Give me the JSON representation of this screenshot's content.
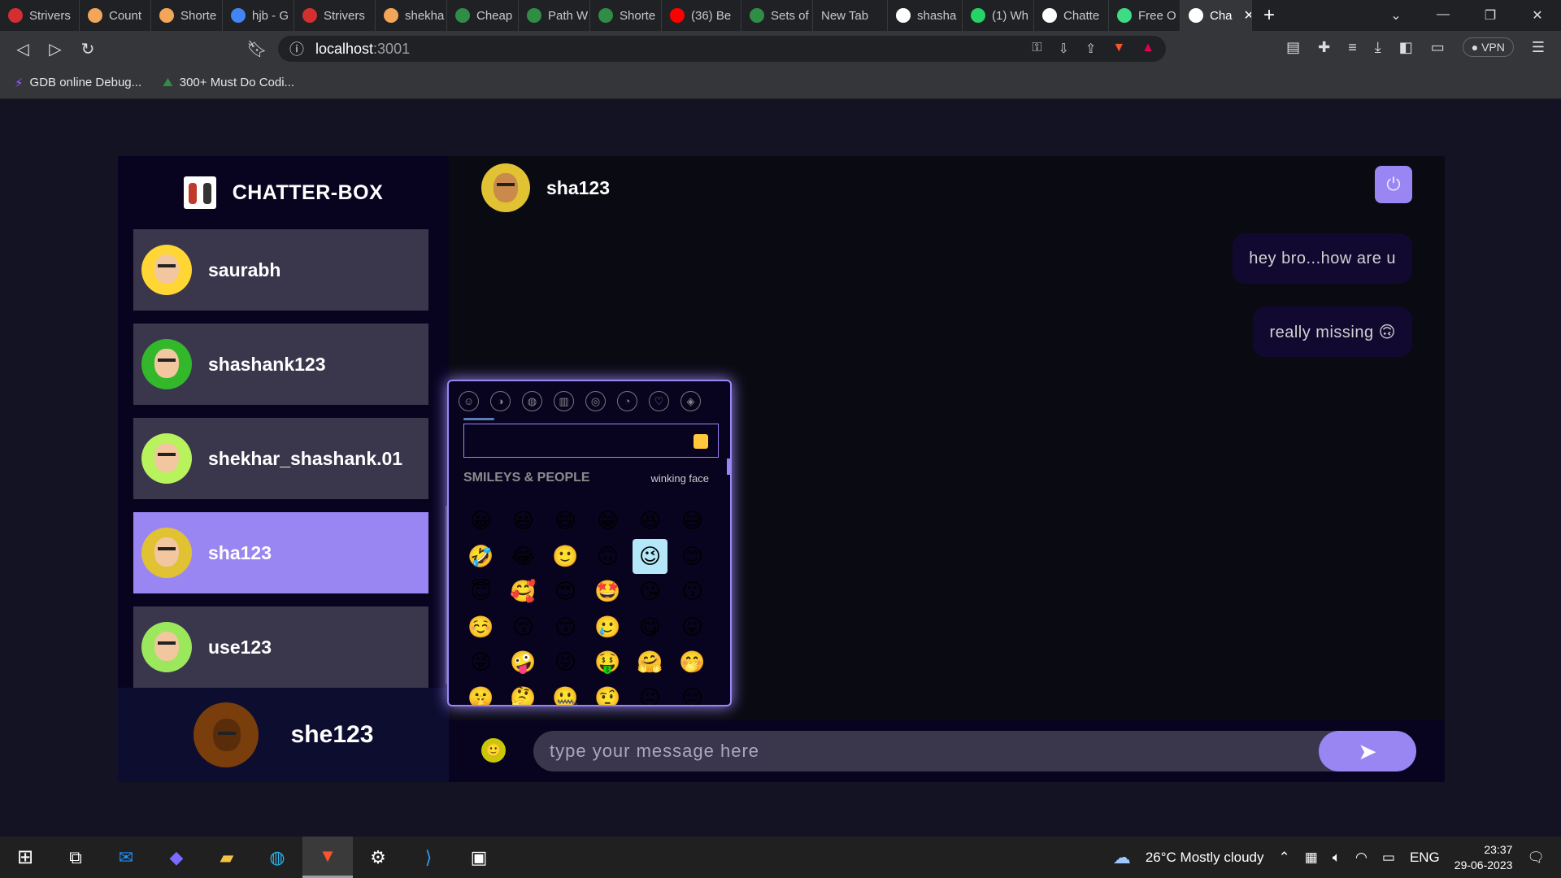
{
  "browser": {
    "tabs": [
      {
        "label": "Strivers",
        "color": "#d32f2f"
      },
      {
        "label": "Count",
        "color": "#f2a65a"
      },
      {
        "label": "Shorte",
        "color": "#f2a65a"
      },
      {
        "label": "hjb - G",
        "color": "#4285f4"
      },
      {
        "label": "Strivers",
        "color": "#d32f2f"
      },
      {
        "label": "shekha",
        "color": "#f2a65a"
      },
      {
        "label": "Cheap",
        "color": "#2f8d46"
      },
      {
        "label": "Path W",
        "color": "#2f8d46"
      },
      {
        "label": "Shorte",
        "color": "#2f8d46"
      },
      {
        "label": "(36) Be",
        "color": "#ff0000"
      },
      {
        "label": "Sets of",
        "color": "#2f8d46"
      },
      {
        "label": "New Tab",
        "color": ""
      },
      {
        "label": "shasha",
        "color": "#ffffff"
      },
      {
        "label": "(1) Wh",
        "color": "#25d366"
      },
      {
        "label": "Chatte",
        "color": "#ffffff"
      },
      {
        "label": "Free O",
        "color": "#3ddc84"
      },
      {
        "label": "Cha",
        "color": "#ffffff",
        "active": true
      }
    ],
    "url_host": "localhost",
    "url_port": ":3001",
    "bookmarks": [
      "GDB online Debug...",
      "300+ Must Do Codi..."
    ],
    "vpn_label": "VPN"
  },
  "app": {
    "brand": "CHATTER-BOX",
    "contacts": [
      {
        "name": "saurabh",
        "avatar_bg": "#ffd633"
      },
      {
        "name": "shashank123",
        "avatar_bg": "#32b82a"
      },
      {
        "name": "shekhar_shashank.01",
        "avatar_bg": "#b8f25c"
      },
      {
        "name": "sha123",
        "avatar_bg": "#e0c233",
        "selected": true
      },
      {
        "name": "use123",
        "avatar_bg": "#9be85c"
      }
    ],
    "current_user": {
      "name": "she123",
      "avatar_bg": "#7a3d0c"
    },
    "chat_header": {
      "name": "sha123",
      "avatar_bg": "#e0c233"
    },
    "messages": [
      {
        "text": "hey bro...how are u"
      },
      {
        "text": "really missing 🙃"
      }
    ],
    "emoji_picker": {
      "section_label": "SMILEYS & PEOPLE",
      "preview": "winking face",
      "emojis": [
        "😀",
        "😃",
        "😄",
        "😁",
        "😆",
        "😅",
        "🤣",
        "😂",
        "🙂",
        "🙃",
        "😉",
        "😊",
        "😇",
        "🥰",
        "😍",
        "🤩",
        "😘",
        "😗",
        "☺️",
        "😚",
        "😙",
        "🥲",
        "😋",
        "😛",
        "😜",
        "🤪",
        "😝",
        "🤑",
        "🤗",
        "🤭",
        "🤫",
        "🤔",
        "🤐",
        "🤨",
        "😐",
        "😑"
      ]
    },
    "input_placeholder": "type your message here"
  },
  "taskbar": {
    "weather": "26°C  Mostly cloudy",
    "lang": "ENG",
    "time": "23:37",
    "date": "29-06-2023"
  }
}
